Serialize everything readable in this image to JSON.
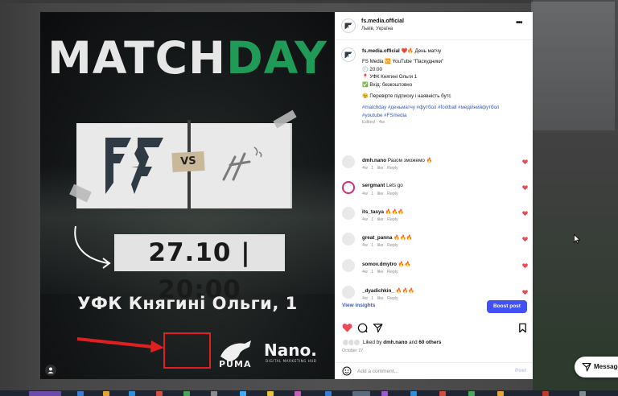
{
  "post_image": {
    "title_white": "MATCH",
    "title_green": "DAY",
    "vs": "VS",
    "date_time": "27.10 | 20:00",
    "venue": "УФК Княгині Ольги, 1",
    "sponsor_puma": "PUMA",
    "sponsor_nano": "Nano.",
    "sponsor_nano_sub": "DIGITAL MARKETING HUB"
  },
  "header": {
    "username": "fs.media.official",
    "location": "Львів, Україна"
  },
  "caption": {
    "username": "fs.media.official",
    "line1": "❤️🔥 День матчу",
    "line2": "FS Media 🆚 YouTube \"Паскудники\"",
    "line3": "🕗 20:00",
    "line4": "📍 УФК Княгині Ольги 1",
    "line5": "✅ Вхід: безкоштовно",
    "line6": "😉 Перевірте підписку і наявність бутс",
    "tags_line1": "#matchday #деньматчу #футбол #football #медійнийфутбол",
    "tags_line2": "#youtube #FSmedia",
    "edited": "Edited · 4w"
  },
  "comments": [
    {
      "user": "dmh.nano",
      "text": "Разом зможемо 🔥",
      "age": "4w",
      "likes": "1 like",
      "reply": "Reply"
    },
    {
      "user": "sergmant",
      "text": "Lets go",
      "age": "4w",
      "likes": "1 like",
      "reply": "Reply"
    },
    {
      "user": "its_tasya",
      "text": "🔥🔥🔥",
      "age": "4w",
      "likes": "1 like",
      "reply": "Reply"
    },
    {
      "user": "great_panna",
      "text": "🔥🔥🔥",
      "age": "4w",
      "likes": "1 like",
      "reply": "Reply"
    },
    {
      "user": "somov.dmytro",
      "text": "🔥🔥",
      "age": "4w",
      "likes": "1 like",
      "reply": "Reply"
    },
    {
      "user": "_dyadichkin_",
      "text": "🔥🔥🔥",
      "age": "4w",
      "likes": "1 like",
      "reply": "Reply"
    }
  ],
  "actions": {
    "view_insights": "View insights",
    "boost_post": "Boost post"
  },
  "likes": {
    "prefix": "Liked by",
    "user": "dmh.nano",
    "middle": "and",
    "others": "60 others"
  },
  "date": "October 27",
  "add_comment": {
    "placeholder": "Add a comment...",
    "post": "Post"
  },
  "messages": {
    "label": "Messages"
  },
  "colors": {
    "accent_blue": "#4150f7",
    "heart_red": "#ed4956",
    "title_green": "#1f9a57",
    "annotation_red": "#e02020"
  }
}
